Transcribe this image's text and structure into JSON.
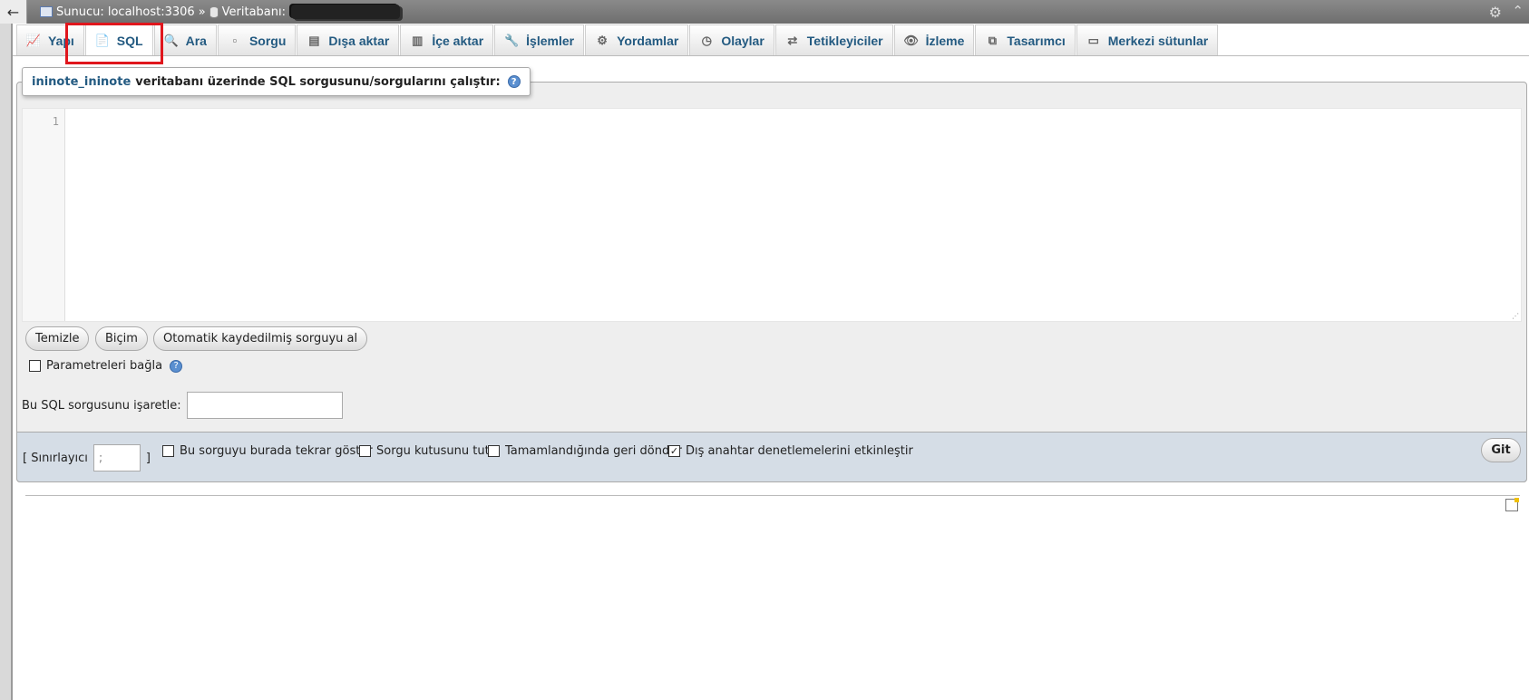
{
  "breadcrumb": {
    "server_label": "Sunucu: localhost:3306",
    "separator": "»",
    "database_label": "Veritabanı:"
  },
  "tabs": [
    {
      "label": "Yapı",
      "icon": "structure-icon"
    },
    {
      "label": "SQL",
      "icon": "sql-icon",
      "active": true
    },
    {
      "label": "Ara",
      "icon": "search-icon"
    },
    {
      "label": "Sorgu",
      "icon": "query-icon"
    },
    {
      "label": "Dışa aktar",
      "icon": "export-icon"
    },
    {
      "label": "İçe aktar",
      "icon": "import-icon"
    },
    {
      "label": "İşlemler",
      "icon": "operations-icon"
    },
    {
      "label": "Yordamlar",
      "icon": "routines-icon"
    },
    {
      "label": "Olaylar",
      "icon": "events-icon"
    },
    {
      "label": "Tetikleyiciler",
      "icon": "triggers-icon"
    },
    {
      "label": "İzleme",
      "icon": "tracking-icon"
    },
    {
      "label": "Tasarımcı",
      "icon": "designer-icon"
    },
    {
      "label": "Merkezi sütunlar",
      "icon": "central-columns-icon"
    }
  ],
  "query_box": {
    "db_name": "ininote_ininote",
    "heading_rest": "veritabanı üzerinde SQL sorgusunu/sorgularını çalıştır:",
    "line_number": "1"
  },
  "buttons": {
    "clear": "Temizle",
    "format": "Biçim",
    "get_autosaved": "Otomatik kaydedilmiş sorguyu al"
  },
  "bind_params_label": "Parametreleri bağla",
  "bookmark_label": "Bu SQL sorgusunu işaretle:",
  "footer": {
    "delimiter_label": "[ Sınırlayıcı",
    "delimiter_close": "]",
    "delimiter_value": ";",
    "options": [
      {
        "label": "Bu sorguyu burada tekrar göster",
        "checked": false
      },
      {
        "label": "Sorgu kutusunu tut",
        "checked": false
      },
      {
        "label": "Tamamlandığında geri döndür",
        "checked": false
      },
      {
        "label": "Dış anahtar denetlemelerini etkinleştir",
        "checked": true
      }
    ],
    "go_label": "Git"
  },
  "colors": {
    "link_blue": "#235a81",
    "highlight_red": "#e0161d",
    "footer_bg": "#d5dde6"
  }
}
